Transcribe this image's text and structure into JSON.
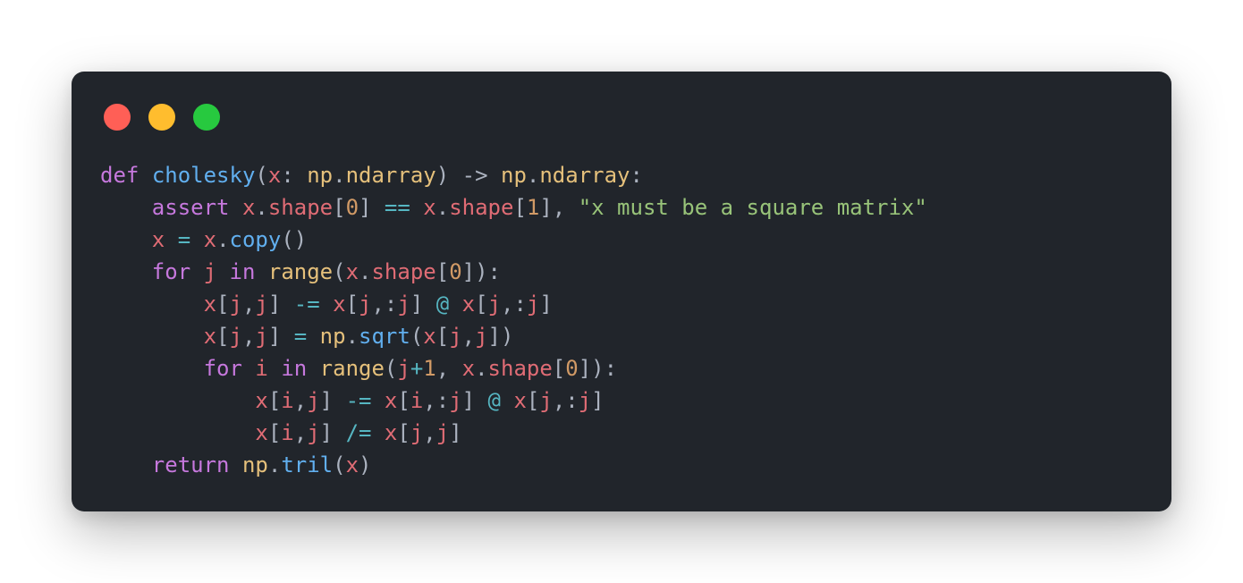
{
  "window": {
    "traffic_lights": [
      {
        "name": "close",
        "color": "#ff5f56"
      },
      {
        "name": "minimize",
        "color": "#ffbd2e"
      },
      {
        "name": "maximize",
        "color": "#27c93f"
      }
    ]
  },
  "theme": {
    "background": "#21252b",
    "keyword": "#c678dd",
    "function": "#61afef",
    "variable": "#e06c75",
    "type": "#e5c07b",
    "number": "#d19a66",
    "string": "#98c379",
    "operator": "#56b6c2",
    "plain": "#abb2bf"
  },
  "code": {
    "language": "python",
    "lines": [
      {
        "indent": 0,
        "tokens": [
          {
            "t": "def",
            "c": "keyword"
          },
          {
            "t": " ",
            "c": "plain"
          },
          {
            "t": "cholesky",
            "c": "function"
          },
          {
            "t": "(",
            "c": "plain"
          },
          {
            "t": "x",
            "c": "variable"
          },
          {
            "t": ": ",
            "c": "plain"
          },
          {
            "t": "np",
            "c": "type"
          },
          {
            "t": ".",
            "c": "plain"
          },
          {
            "t": "ndarray",
            "c": "type"
          },
          {
            "t": ") ",
            "c": "plain"
          },
          {
            "t": "->",
            "c": "plain"
          },
          {
            "t": " ",
            "c": "plain"
          },
          {
            "t": "np",
            "c": "type"
          },
          {
            "t": ".",
            "c": "plain"
          },
          {
            "t": "ndarray",
            "c": "type"
          },
          {
            "t": ":",
            "c": "plain"
          }
        ]
      },
      {
        "indent": 1,
        "tokens": [
          {
            "t": "assert",
            "c": "keyword"
          },
          {
            "t": " ",
            "c": "plain"
          },
          {
            "t": "x",
            "c": "variable"
          },
          {
            "t": ".",
            "c": "plain"
          },
          {
            "t": "shape",
            "c": "variable"
          },
          {
            "t": "[",
            "c": "plain"
          },
          {
            "t": "0",
            "c": "number"
          },
          {
            "t": "] ",
            "c": "plain"
          },
          {
            "t": "==",
            "c": "operator"
          },
          {
            "t": " ",
            "c": "plain"
          },
          {
            "t": "x",
            "c": "variable"
          },
          {
            "t": ".",
            "c": "plain"
          },
          {
            "t": "shape",
            "c": "variable"
          },
          {
            "t": "[",
            "c": "plain"
          },
          {
            "t": "1",
            "c": "number"
          },
          {
            "t": "], ",
            "c": "plain"
          },
          {
            "t": "\"x must be a square matrix\"",
            "c": "string"
          }
        ]
      },
      {
        "indent": 1,
        "tokens": [
          {
            "t": "x",
            "c": "variable"
          },
          {
            "t": " ",
            "c": "plain"
          },
          {
            "t": "=",
            "c": "operator"
          },
          {
            "t": " ",
            "c": "plain"
          },
          {
            "t": "x",
            "c": "variable"
          },
          {
            "t": ".",
            "c": "plain"
          },
          {
            "t": "copy",
            "c": "function"
          },
          {
            "t": "()",
            "c": "plain"
          }
        ]
      },
      {
        "indent": 1,
        "tokens": [
          {
            "t": "for",
            "c": "keyword"
          },
          {
            "t": " ",
            "c": "plain"
          },
          {
            "t": "j",
            "c": "variable"
          },
          {
            "t": " ",
            "c": "plain"
          },
          {
            "t": "in",
            "c": "keyword"
          },
          {
            "t": " ",
            "c": "plain"
          },
          {
            "t": "range",
            "c": "type"
          },
          {
            "t": "(",
            "c": "plain"
          },
          {
            "t": "x",
            "c": "variable"
          },
          {
            "t": ".",
            "c": "plain"
          },
          {
            "t": "shape",
            "c": "variable"
          },
          {
            "t": "[",
            "c": "plain"
          },
          {
            "t": "0",
            "c": "number"
          },
          {
            "t": "]):",
            "c": "plain"
          }
        ]
      },
      {
        "indent": 2,
        "tokens": [
          {
            "t": "x",
            "c": "variable"
          },
          {
            "t": "[",
            "c": "plain"
          },
          {
            "t": "j",
            "c": "variable"
          },
          {
            "t": ",",
            "c": "plain"
          },
          {
            "t": "j",
            "c": "variable"
          },
          {
            "t": "] ",
            "c": "plain"
          },
          {
            "t": "-=",
            "c": "operator"
          },
          {
            "t": " ",
            "c": "plain"
          },
          {
            "t": "x",
            "c": "variable"
          },
          {
            "t": "[",
            "c": "plain"
          },
          {
            "t": "j",
            "c": "variable"
          },
          {
            "t": ",:",
            "c": "plain"
          },
          {
            "t": "j",
            "c": "variable"
          },
          {
            "t": "] ",
            "c": "plain"
          },
          {
            "t": "@",
            "c": "operator"
          },
          {
            "t": " ",
            "c": "plain"
          },
          {
            "t": "x",
            "c": "variable"
          },
          {
            "t": "[",
            "c": "plain"
          },
          {
            "t": "j",
            "c": "variable"
          },
          {
            "t": ",:",
            "c": "plain"
          },
          {
            "t": "j",
            "c": "variable"
          },
          {
            "t": "]",
            "c": "plain"
          }
        ]
      },
      {
        "indent": 2,
        "tokens": [
          {
            "t": "x",
            "c": "variable"
          },
          {
            "t": "[",
            "c": "plain"
          },
          {
            "t": "j",
            "c": "variable"
          },
          {
            "t": ",",
            "c": "plain"
          },
          {
            "t": "j",
            "c": "variable"
          },
          {
            "t": "] ",
            "c": "plain"
          },
          {
            "t": "=",
            "c": "operator"
          },
          {
            "t": " ",
            "c": "plain"
          },
          {
            "t": "np",
            "c": "type"
          },
          {
            "t": ".",
            "c": "plain"
          },
          {
            "t": "sqrt",
            "c": "function"
          },
          {
            "t": "(",
            "c": "plain"
          },
          {
            "t": "x",
            "c": "variable"
          },
          {
            "t": "[",
            "c": "plain"
          },
          {
            "t": "j",
            "c": "variable"
          },
          {
            "t": ",",
            "c": "plain"
          },
          {
            "t": "j",
            "c": "variable"
          },
          {
            "t": "])",
            "c": "plain"
          }
        ]
      },
      {
        "indent": 2,
        "tokens": [
          {
            "t": "for",
            "c": "keyword"
          },
          {
            "t": " ",
            "c": "plain"
          },
          {
            "t": "i",
            "c": "variable"
          },
          {
            "t": " ",
            "c": "plain"
          },
          {
            "t": "in",
            "c": "keyword"
          },
          {
            "t": " ",
            "c": "plain"
          },
          {
            "t": "range",
            "c": "type"
          },
          {
            "t": "(",
            "c": "plain"
          },
          {
            "t": "j",
            "c": "variable"
          },
          {
            "t": "+",
            "c": "operator"
          },
          {
            "t": "1",
            "c": "number"
          },
          {
            "t": ", ",
            "c": "plain"
          },
          {
            "t": "x",
            "c": "variable"
          },
          {
            "t": ".",
            "c": "plain"
          },
          {
            "t": "shape",
            "c": "variable"
          },
          {
            "t": "[",
            "c": "plain"
          },
          {
            "t": "0",
            "c": "number"
          },
          {
            "t": "]):",
            "c": "plain"
          }
        ]
      },
      {
        "indent": 3,
        "tokens": [
          {
            "t": "x",
            "c": "variable"
          },
          {
            "t": "[",
            "c": "plain"
          },
          {
            "t": "i",
            "c": "variable"
          },
          {
            "t": ",",
            "c": "plain"
          },
          {
            "t": "j",
            "c": "variable"
          },
          {
            "t": "] ",
            "c": "plain"
          },
          {
            "t": "-=",
            "c": "operator"
          },
          {
            "t": " ",
            "c": "plain"
          },
          {
            "t": "x",
            "c": "variable"
          },
          {
            "t": "[",
            "c": "plain"
          },
          {
            "t": "i",
            "c": "variable"
          },
          {
            "t": ",:",
            "c": "plain"
          },
          {
            "t": "j",
            "c": "variable"
          },
          {
            "t": "] ",
            "c": "plain"
          },
          {
            "t": "@",
            "c": "operator"
          },
          {
            "t": " ",
            "c": "plain"
          },
          {
            "t": "x",
            "c": "variable"
          },
          {
            "t": "[",
            "c": "plain"
          },
          {
            "t": "j",
            "c": "variable"
          },
          {
            "t": ",:",
            "c": "plain"
          },
          {
            "t": "j",
            "c": "variable"
          },
          {
            "t": "]",
            "c": "plain"
          }
        ]
      },
      {
        "indent": 3,
        "tokens": [
          {
            "t": "x",
            "c": "variable"
          },
          {
            "t": "[",
            "c": "plain"
          },
          {
            "t": "i",
            "c": "variable"
          },
          {
            "t": ",",
            "c": "plain"
          },
          {
            "t": "j",
            "c": "variable"
          },
          {
            "t": "] ",
            "c": "plain"
          },
          {
            "t": "/=",
            "c": "operator"
          },
          {
            "t": " ",
            "c": "plain"
          },
          {
            "t": "x",
            "c": "variable"
          },
          {
            "t": "[",
            "c": "plain"
          },
          {
            "t": "j",
            "c": "variable"
          },
          {
            "t": ",",
            "c": "plain"
          },
          {
            "t": "j",
            "c": "variable"
          },
          {
            "t": "]",
            "c": "plain"
          }
        ]
      },
      {
        "indent": 1,
        "tokens": [
          {
            "t": "return",
            "c": "keyword"
          },
          {
            "t": " ",
            "c": "plain"
          },
          {
            "t": "np",
            "c": "type"
          },
          {
            "t": ".",
            "c": "plain"
          },
          {
            "t": "tril",
            "c": "function"
          },
          {
            "t": "(",
            "c": "plain"
          },
          {
            "t": "x",
            "c": "variable"
          },
          {
            "t": ")",
            "c": "plain"
          }
        ]
      }
    ]
  }
}
